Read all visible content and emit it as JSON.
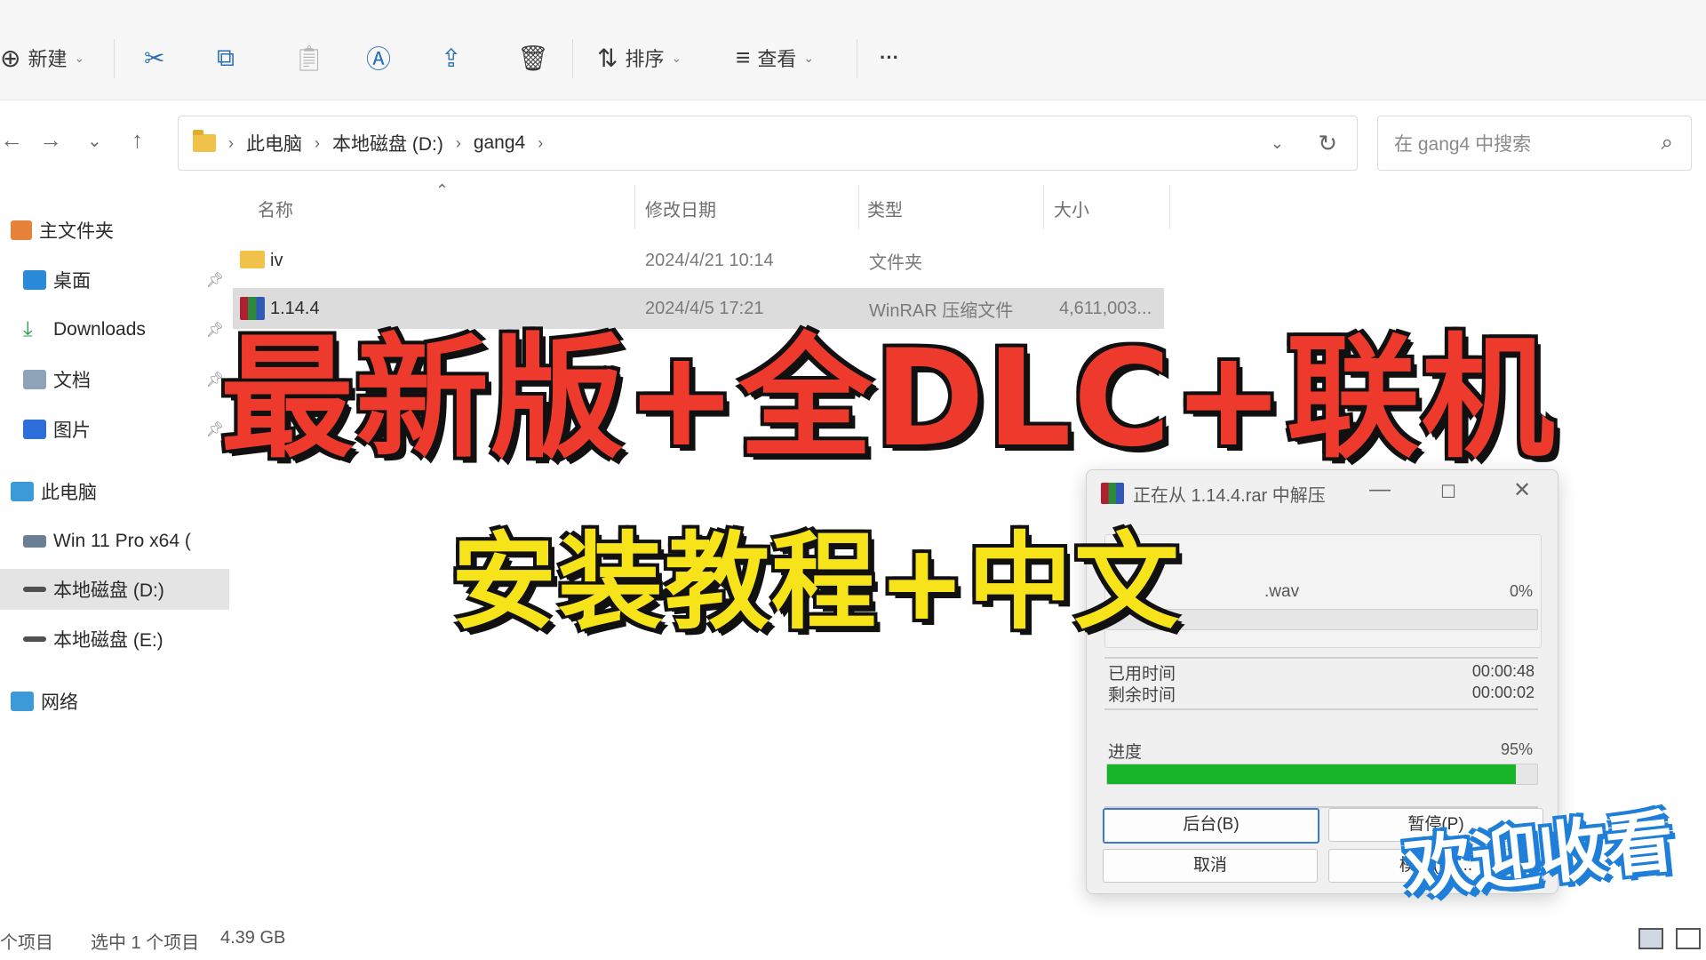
{
  "toolbar": {
    "new_label": "新建",
    "sort_label": "排序",
    "view_label": "查看",
    "more_label": "···"
  },
  "address": {
    "crumbs": [
      "此电脑",
      "本地磁盘 (D:)",
      "gang4"
    ],
    "search_placeholder": "在 gang4 中搜索"
  },
  "sidebar": {
    "items": [
      {
        "label": "主文件夹"
      },
      {
        "label": "桌面"
      },
      {
        "label": "Downloads"
      },
      {
        "label": "文档"
      },
      {
        "label": "图片"
      },
      {
        "label": "此电脑"
      },
      {
        "label": "Win 11 Pro x64 ("
      },
      {
        "label": "本地磁盘 (D:)"
      },
      {
        "label": "本地磁盘 (E:)"
      },
      {
        "label": "网络"
      }
    ]
  },
  "columns": {
    "name": "名称",
    "modified": "修改日期",
    "type": "类型",
    "size": "大小"
  },
  "files": [
    {
      "name": "iv",
      "modified": "2024/4/21 10:14",
      "type": "文件夹",
      "size": ""
    },
    {
      "name": "1.14.4",
      "modified": "2024/4/5 17:21",
      "type": "WinRAR 压缩文件",
      "size": "4,611,003..."
    }
  ],
  "status": {
    "count": "个项目",
    "selected": "选中 1 个项目",
    "size": "4.39 GB"
  },
  "overlay": {
    "title_line1": "最新版+全DLC+联机",
    "title_line2": "安装教程+中文",
    "welcome": "欢迎收看"
  },
  "dialog": {
    "title": "正在从 1.14.4.rar 中解压",
    "file": ".wav",
    "file_percent": "0%",
    "file_progress": 0,
    "elapsed_label": "已用时间",
    "elapsed_value": "00:00:48",
    "remaining_label": "剩余时间",
    "remaining_value": "00:00:02",
    "progress_label": "进度",
    "progress_percent": "95%",
    "progress": 0.95,
    "btn_background": "后台(B)",
    "btn_pause": "暂停(P)",
    "btn_cancel": "取消",
    "btn_mode": "模式(M)..."
  },
  "colors": {
    "title_red": "#ee3a2c",
    "title_yellow": "#f7e31a",
    "progress_green": "#18b52b",
    "welcome_blue": "#1f7fd8"
  }
}
